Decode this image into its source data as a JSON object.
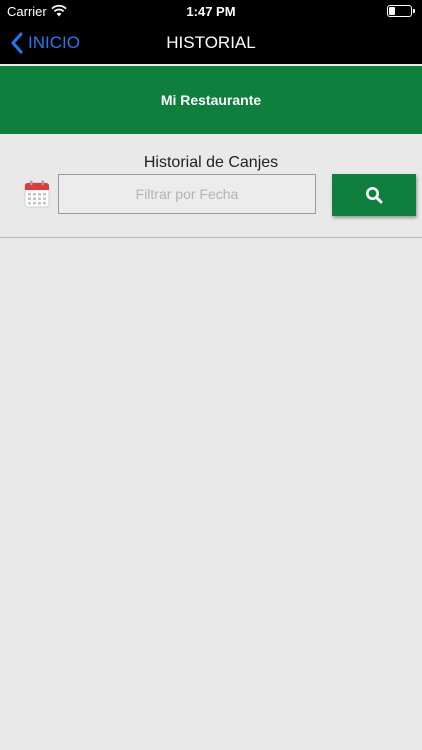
{
  "status_bar": {
    "carrier": "Carrier",
    "time": "1:47 PM"
  },
  "nav": {
    "back_label": "INICIO",
    "title": "HISTORIAL"
  },
  "banner": {
    "restaurant_name": "Mi Restaurante"
  },
  "filter": {
    "title": "Historial de Canjes",
    "date_input": {
      "value": "",
      "placeholder": "Filtrar por Fecha"
    },
    "search_button_icon": "search-icon",
    "calendar_icon": "calendar-icon"
  },
  "results": [],
  "colors": {
    "brand_green": "#0f7f3e",
    "link_blue": "#1e7cf0",
    "background": "#e9e9e9"
  }
}
